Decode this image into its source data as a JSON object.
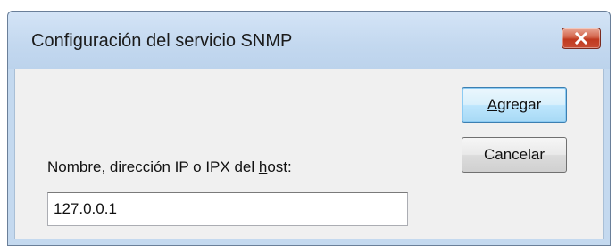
{
  "window": {
    "title": "Configuración del servicio SNMP",
    "close_icon": "close-icon"
  },
  "buttons": {
    "add": {
      "mnemonic": "A",
      "rest": "gregar"
    },
    "cancel": {
      "label": "Cancelar"
    }
  },
  "host_field": {
    "label_before": "Nombre, dirección IP o IPX del ",
    "label_mnemonic": "h",
    "label_after": "ost:",
    "value": "127.0.0.1"
  },
  "colors": {
    "titlebar": "#c4d9ef",
    "close_button": "#c84c33",
    "client_area": "#f0f0f0",
    "default_button_border": "#3c7fb1"
  }
}
